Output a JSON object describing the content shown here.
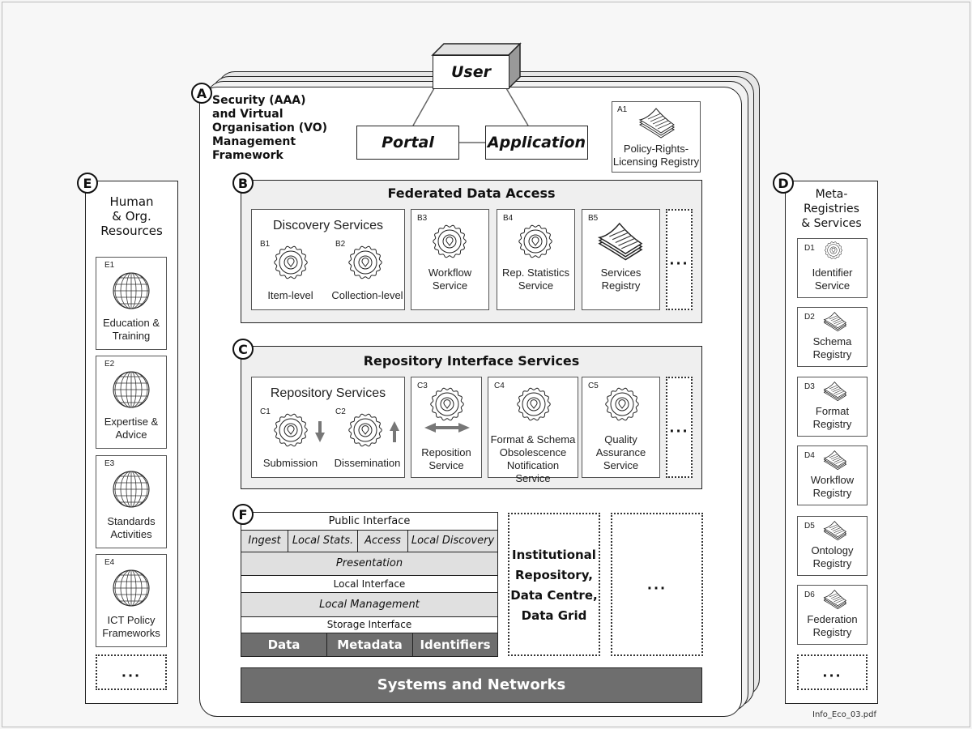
{
  "user": {
    "label": "User"
  },
  "portal": {
    "label": "Portal"
  },
  "application": {
    "label": "Application"
  },
  "footer": {
    "filename": "Info_Eco_03.pdf"
  },
  "sectionA": {
    "badge": "A",
    "title_lines": [
      "Security (AAA)",
      "and Virtual",
      "Organisation (VO)",
      "Management",
      "Framework"
    ],
    "a1": {
      "code": "A1",
      "lines": [
        "Policy-Rights-",
        "Licensing Registry"
      ],
      "icon": "document-stack-icon"
    }
  },
  "sectionB": {
    "badge": "B",
    "title": "Federated Data Access",
    "discovery": {
      "title": "Discovery Services",
      "items": [
        {
          "code": "B1",
          "label": "Item-level",
          "icon": "gear-icon"
        },
        {
          "code": "B2",
          "label": "Collection-level",
          "icon": "gear-icon"
        }
      ]
    },
    "services": [
      {
        "code": "B3",
        "lines": [
          "Workflow",
          "Service"
        ],
        "icon": "gear-icon"
      },
      {
        "code": "B4",
        "lines": [
          "Rep. Statistics",
          "Service"
        ],
        "icon": "gear-icon"
      },
      {
        "code": "B5",
        "lines": [
          "Services",
          "Registry"
        ],
        "icon": "document-stack-icon"
      }
    ],
    "more": "..."
  },
  "sectionC": {
    "badge": "C",
    "title": "Repository Interface Services",
    "repo": {
      "title": "Repository Services",
      "items": [
        {
          "code": "C1",
          "label": "Submission",
          "icon": "gear-icon",
          "arrow": "arrow-down-icon"
        },
        {
          "code": "C2",
          "label": "Dissemination",
          "icon": "gear-icon",
          "arrow": "arrow-up-icon"
        }
      ]
    },
    "services": [
      {
        "code": "C3",
        "lines": [
          "Reposition",
          "Service"
        ],
        "icon": "gear-icon"
      },
      {
        "code": "C4",
        "lines": [
          "Format & Schema",
          "Obsolescence",
          "Notification Service"
        ],
        "icon": "gear-icon"
      },
      {
        "code": "C5",
        "lines": [
          "Quality",
          "Assurance",
          "Service"
        ],
        "icon": "gear-icon"
      }
    ],
    "more": "..."
  },
  "sectionF": {
    "badge": "F",
    "public_interface": "Public Interface",
    "access_row": [
      "Ingest",
      "Local Stats.",
      "Access",
      "Local Discovery"
    ],
    "presentation": "Presentation",
    "local_interface": "Local Interface",
    "local_management": "Local Management",
    "storage_interface": "Storage Interface",
    "storage_row": [
      "Data",
      "Metadata",
      "Identifiers"
    ],
    "institutional_lines": [
      "Institutional",
      "Repository,",
      "Data Centre,",
      "Data Grid"
    ],
    "more": "..."
  },
  "systems": {
    "label": "Systems and Networks"
  },
  "sectionE": {
    "badge": "E",
    "title_lines": [
      "Human",
      "& Org.",
      "Resources"
    ],
    "items": [
      {
        "code": "E1",
        "lines": [
          "Education &",
          "Training"
        ],
        "icon": "globe-icon"
      },
      {
        "code": "E2",
        "lines": [
          "Expertise &",
          "Advice"
        ],
        "icon": "globe-icon"
      },
      {
        "code": "E3",
        "lines": [
          "Standards",
          "Activities"
        ],
        "icon": "globe-icon"
      },
      {
        "code": "E4",
        "lines": [
          "ICT Policy",
          "Frameworks"
        ],
        "icon": "globe-icon"
      }
    ],
    "more": "..."
  },
  "sectionD": {
    "badge": "D",
    "title_lines": [
      "Meta-",
      "Registries",
      "& Services"
    ],
    "items": [
      {
        "code": "D1",
        "lines": [
          "Identifier",
          "Service"
        ],
        "icon": "gear-icon"
      },
      {
        "code": "D2",
        "lines": [
          "Schema",
          "Registry"
        ],
        "icon": "document-stack-icon"
      },
      {
        "code": "D3",
        "lines": [
          "Format",
          "Registry"
        ],
        "icon": "document-stack-icon"
      },
      {
        "code": "D4",
        "lines": [
          "Workflow",
          "Registry"
        ],
        "icon": "document-stack-icon"
      },
      {
        "code": "D5",
        "lines": [
          "Ontology",
          "Registry"
        ],
        "icon": "document-stack-icon"
      },
      {
        "code": "D6",
        "lines": [
          "Federation",
          "Registry"
        ],
        "icon": "document-stack-icon"
      }
    ],
    "more": "..."
  }
}
